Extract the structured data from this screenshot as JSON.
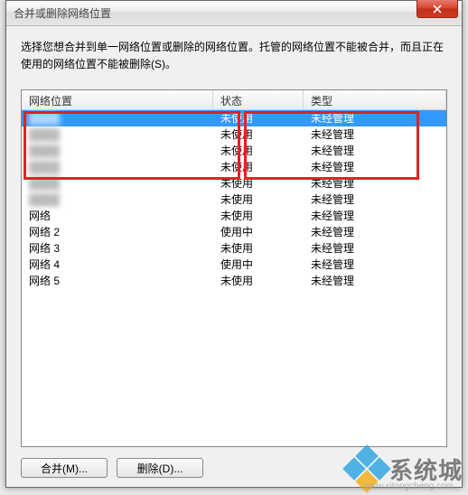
{
  "window": {
    "title": "合并或删除网络位置"
  },
  "description": "选择您想合并到单一网络位置或删除的网络位置。托管的网络位置不能被合并，而且正在使用的网络位置不能被删除(S)。",
  "columns": {
    "name": "网络位置",
    "status": "状态",
    "type": "类型"
  },
  "rows": [
    {
      "name": "",
      "name_blur": true,
      "status": "未使用",
      "type": "未经管理",
      "selected": true
    },
    {
      "name": "",
      "name_blur": true,
      "status": "未使用",
      "type": "未经管理"
    },
    {
      "name": "",
      "name_blur": true,
      "status": "未使用",
      "type": "未经管理"
    },
    {
      "name": "",
      "name_blur": true,
      "status": "未使用",
      "type": "未经管理"
    },
    {
      "name": "",
      "name_blur": true,
      "status": "未使用",
      "type": "未经管理"
    },
    {
      "name": "",
      "name_blur": true,
      "status": "未使用",
      "type": "未经管理"
    },
    {
      "name": "网络",
      "status": "未使用",
      "type": "未经管理"
    },
    {
      "name": "网络  2",
      "status": "使用中",
      "type": "未经管理"
    },
    {
      "name": "网络  3",
      "status": "未使用",
      "type": "未经管理"
    },
    {
      "name": "网络  4",
      "status": "使用中",
      "type": "未经管理"
    },
    {
      "name": "网络  5",
      "status": "未使用",
      "type": "未经管理"
    }
  ],
  "buttons": {
    "merge": "合并(M)...",
    "delete": "删除(D)..."
  },
  "watermark": {
    "text": "系统城",
    "url": "www.xitongcheng.com"
  }
}
